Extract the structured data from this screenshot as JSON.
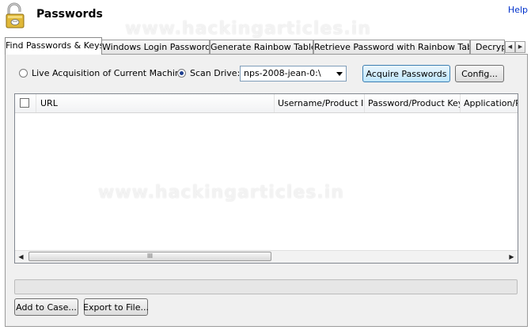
{
  "header": {
    "title": "Passwords",
    "help_label": "Help"
  },
  "tabs": [
    {
      "label": "Find Passwords & Keys",
      "active": true
    },
    {
      "label": "Windows Login Passwords",
      "active": false
    },
    {
      "label": "Generate Rainbow Table",
      "active": false
    },
    {
      "label": "Retrieve Password with Rainbow Table",
      "active": false
    },
    {
      "label": "Decryp",
      "active": false
    }
  ],
  "source": {
    "live_label": "Live Acquisition of Current Machine",
    "scan_label": "Scan Drive:",
    "selected": "scan",
    "drive_value": "nps-2008-jean-0:\\"
  },
  "actions": {
    "acquire_label": "Acquire Passwords",
    "config_label": "Config..."
  },
  "grid": {
    "columns": [
      "URL",
      "Username/Product ID",
      "Password/Product Key",
      "Application/P"
    ],
    "rows": [],
    "scroll_grip": "III"
  },
  "footer": {
    "add_to_case_label": "Add to Case...",
    "export_label": "Export to File..."
  },
  "watermark": "www.hackingarticles.in",
  "colors": {
    "help_link": "#0033cc",
    "primary_button": "#bee6fd"
  }
}
